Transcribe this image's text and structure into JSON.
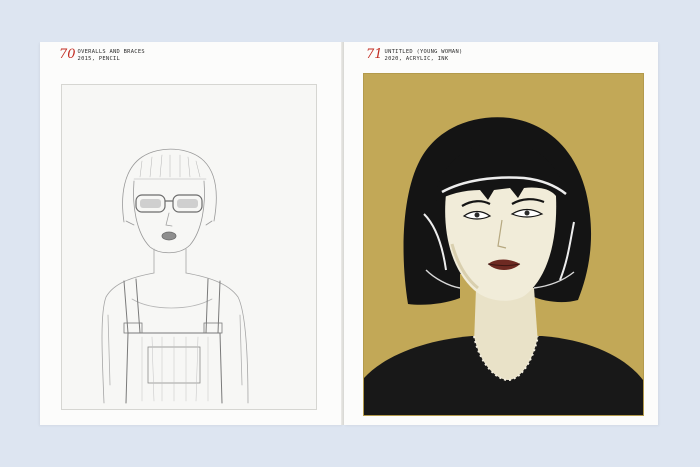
{
  "spread": {
    "left_page": {
      "plate_number": "70",
      "title": "OVERALLS AND BRACES",
      "details": "2015, PENCIL",
      "artwork": "pencil-sketch-girl-in-sunglasses"
    },
    "right_page": {
      "plate_number": "71",
      "title": "UNTITLED (YOUNG WOMAN)",
      "details": "2020, ACRYLIC, INK",
      "artwork": "painted-portrait-woman-black-bob"
    }
  },
  "colors": {
    "background": "#dde5f1",
    "paper": "#fcfcfb",
    "plate_number": "#c22b21",
    "painting_ground": "#c2a857",
    "hair": "#141414",
    "skin": "#f1ecd9"
  }
}
